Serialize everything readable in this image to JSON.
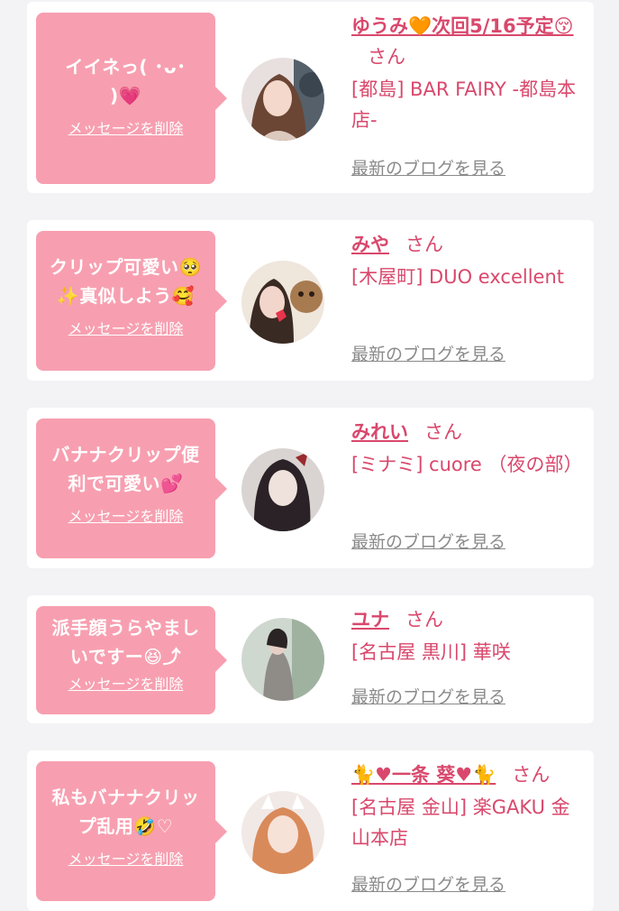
{
  "delete_label": "メッセージを削除",
  "blog_label": "最新のブログを見る",
  "san_label": "さん",
  "entries": [
    {
      "message_line1": "イイネっ( ･ᴗ･",
      "message_line2": ")💗",
      "name": "ゆうみ🧡次回5/16予定😚",
      "shop": "[都島] BAR FAIRY -都島本店-"
    },
    {
      "message_line1": "クリップ可愛い🥺",
      "message_line2": "✨真似しよう🥰",
      "name": "みや",
      "shop": "[木屋町] DUO excellent"
    },
    {
      "message_line1": "バナナクリップ便",
      "message_line2": "利で可愛い💕",
      "name": "みれい",
      "shop": "[ミナミ] cuore （夜の部）"
    },
    {
      "message_line1": "派手顔うらやまし",
      "message_line2": "いですー😆⤴︎",
      "name": "ユナ",
      "shop": "[名古屋 黒川] 華咲"
    },
    {
      "message_line1": "私もバナナクリッ",
      "message_line2": "プ乱用🤣♡",
      "name": "🐈♥一条 葵♥🐈",
      "shop": "[名古屋 金山] 楽GAKU 金山本店"
    }
  ],
  "colors": {
    "bubble": "#f79fb0",
    "accent": "#d9486c",
    "muted": "#8a8a8a",
    "background": "#f3f2f4"
  }
}
